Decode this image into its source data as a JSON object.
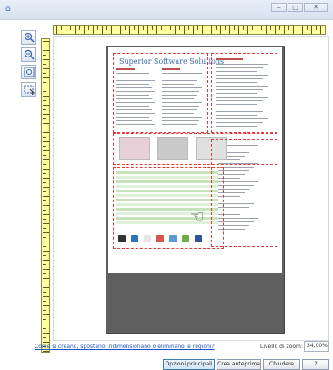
{
  "window": {
    "app_icon": "scanner-icon",
    "minimize_label": "‒",
    "maximize_label": "□",
    "close_label": "✕"
  },
  "toolbar": {
    "tools": [
      "zoom-in-icon",
      "zoom-out-icon",
      "fit-page-icon",
      "select-region-icon"
    ]
  },
  "document": {
    "title": "Superior Software Solutions"
  },
  "footer": {
    "link_text": "Come si creano, spostano, ridimensionano o eliminano le regioni?",
    "zoom_label": "Livello di zoom:",
    "zoom_value": "34,00%"
  },
  "buttons": {
    "main_options": "Opzioni principali",
    "create_preview": "Crea anteprima",
    "close": "Chiudere",
    "help": "?"
  },
  "colors": {
    "ruler": "#ffff9f",
    "region_border": "#e23a3a",
    "link": "#1f52c6",
    "doc_title": "#3a6aa8"
  }
}
